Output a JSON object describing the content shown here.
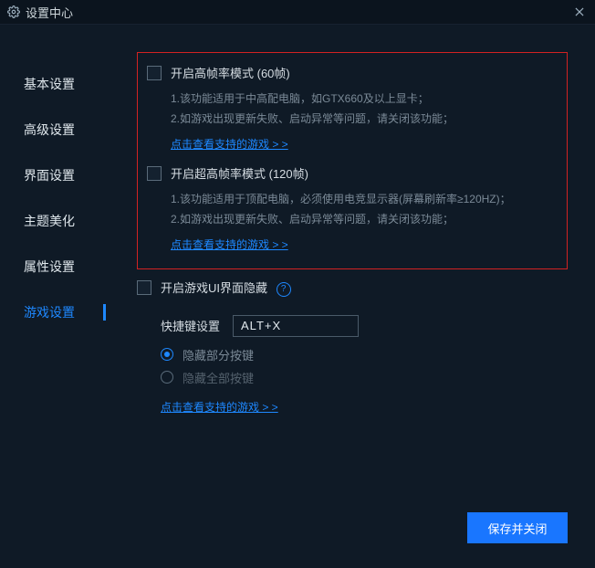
{
  "titlebar": {
    "title": "设置中心"
  },
  "sidebar": {
    "items": [
      {
        "label": "基本设置"
      },
      {
        "label": "高级设置"
      },
      {
        "label": "界面设置"
      },
      {
        "label": "主题美化"
      },
      {
        "label": "属性设置"
      },
      {
        "label": "游戏设置"
      }
    ],
    "activeIndex": 5
  },
  "option60": {
    "title": "开启高帧率模式 (60帧)",
    "desc1": "1.该功能适用于中高配电脑，如GTX660及以上显卡；",
    "desc2": "2.如游戏出现更新失败、启动异常等问题，请关闭该功能；",
    "link": "点击查看支持的游戏  > >"
  },
  "option120": {
    "title": "开启超高帧率模式 (120帧)",
    "desc1": "1.该功能适用于顶配电脑，必须使用电竞显示器(屏幕刷新率≥120HZ)；",
    "desc2": "2.如游戏出现更新失败、启动异常等问题，请关闭该功能；",
    "link": "点击查看支持的游戏  > >"
  },
  "hideUI": {
    "title": "开启游戏UI界面隐藏",
    "hotkeyLabel": "快捷键设置",
    "hotkeyValue": "ALT+X",
    "radio1": "隐藏部分按键",
    "radio2": "隐藏全部按键",
    "link": "点击查看支持的游戏  > >"
  },
  "footer": {
    "save": "保存并关闭"
  }
}
